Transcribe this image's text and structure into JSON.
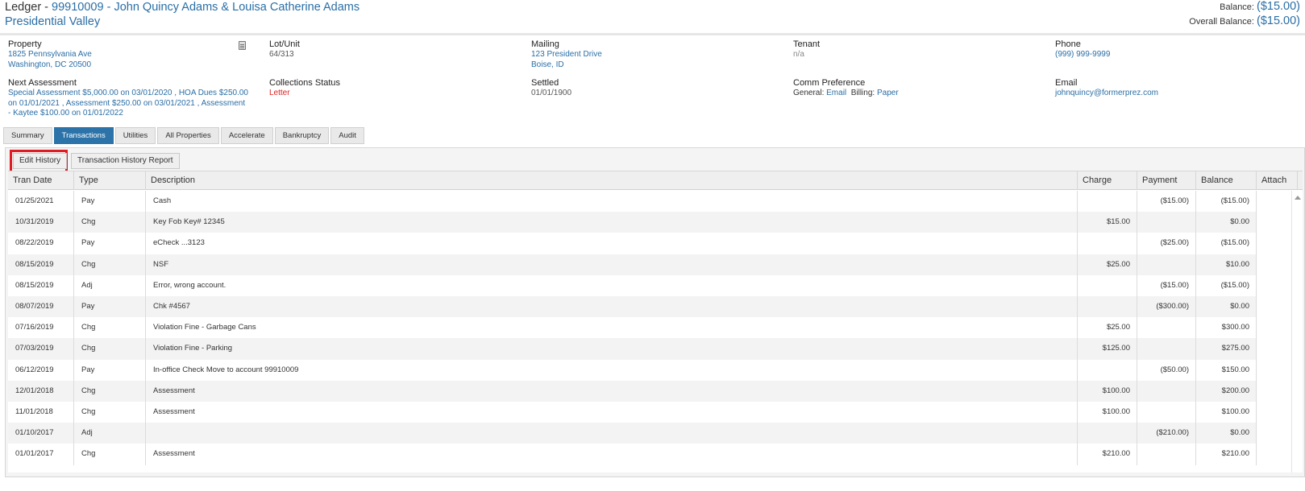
{
  "header": {
    "prefix": "Ledger - ",
    "account_link": "99910009 - John Quincy Adams & Louisa Catherine Adams",
    "community": "Presidential Valley",
    "balance_label": "Balance:",
    "balance_value": "($15.00)",
    "overall_label": "Overall Balance:",
    "overall_value": "($15.00)"
  },
  "info": {
    "property": {
      "label": "Property",
      "line1": "1825 Pennsylvania Ave",
      "line2": "Washington, DC 20500"
    },
    "lot": {
      "label": "Lot/Unit",
      "value": "64/313"
    },
    "mailing": {
      "label": "Mailing",
      "line1": "123 President Drive",
      "line2": "Boise, ID"
    },
    "tenant": {
      "label": "Tenant",
      "value": "n/a"
    },
    "phone": {
      "label": "Phone",
      "value": "(999) 999-9999"
    },
    "next_assessment": {
      "label": "Next Assessment",
      "line1": "Special Assessment $5,000.00 on 03/01/2020 , HOA Dues $250.00",
      "line2": "on 01/01/2021 , Assessment $250.00 on 03/01/2021 , Assessment",
      "line3": "- Kaytee $100.00 on 01/01/2022"
    },
    "collections": {
      "label": "Collections Status",
      "value": "Letter"
    },
    "settled": {
      "label": "Settled",
      "value": "01/01/1900"
    },
    "comm": {
      "label": "Comm Preference",
      "general_label": "General:",
      "general_value": "Email",
      "billing_label": "Billing:",
      "billing_value": "Paper"
    },
    "email": {
      "label": "Email",
      "value": "johnquincy@formerprez.com"
    }
  },
  "tabs": [
    "Summary",
    "Transactions",
    "Utilities",
    "All Properties",
    "Accelerate",
    "Bankruptcy",
    "Audit"
  ],
  "active_tab": "Transactions",
  "toolbar": {
    "edit_history": "Edit History",
    "report": "Transaction History Report"
  },
  "table": {
    "columns": [
      "Tran Date",
      "Type",
      "Description",
      "Charge",
      "Payment",
      "Balance",
      "Attach"
    ],
    "rows": [
      [
        "01/25/2021",
        "Pay",
        "Cash",
        "",
        "($15.00)",
        "($15.00)"
      ],
      [
        "10/31/2019",
        "Chg",
        "Key Fob Key# 12345",
        "$15.00",
        "",
        "$0.00"
      ],
      [
        "08/22/2019",
        "Pay",
        "eCheck ...3123",
        "",
        "($25.00)",
        "($15.00)"
      ],
      [
        "08/15/2019",
        "Chg",
        "NSF",
        "$25.00",
        "",
        "$10.00"
      ],
      [
        "08/15/2019",
        "Adj",
        "Error, wrong account.",
        "",
        "($15.00)",
        "($15.00)"
      ],
      [
        "08/07/2019",
        "Pay",
        "Chk #4567",
        "",
        "($300.00)",
        "$0.00"
      ],
      [
        "07/16/2019",
        "Chg",
        "Violation Fine - Garbage Cans",
        "$25.00",
        "",
        "$300.00"
      ],
      [
        "07/03/2019",
        "Chg",
        "Violation Fine - Parking",
        "$125.00",
        "",
        "$275.00"
      ],
      [
        "06/12/2019",
        "Pay",
        "In-office Check Move to account 99910009",
        "",
        "($50.00)",
        "$150.00"
      ],
      [
        "12/01/2018",
        "Chg",
        "Assessment",
        "$100.00",
        "",
        "$200.00"
      ],
      [
        "11/01/2018",
        "Chg",
        "Assessment",
        "$100.00",
        "",
        "$100.00"
      ],
      [
        "01/10/2017",
        "Adj",
        "",
        "",
        "($210.00)",
        "$0.00"
      ],
      [
        "01/01/2017",
        "Chg",
        "Assessment",
        "$210.00",
        "",
        "$210.00"
      ]
    ]
  },
  "colors": {
    "link": "#2a6ea6",
    "tab_active": "#2b73a8",
    "alert": "#d22",
    "highlight": "#e01b24"
  }
}
